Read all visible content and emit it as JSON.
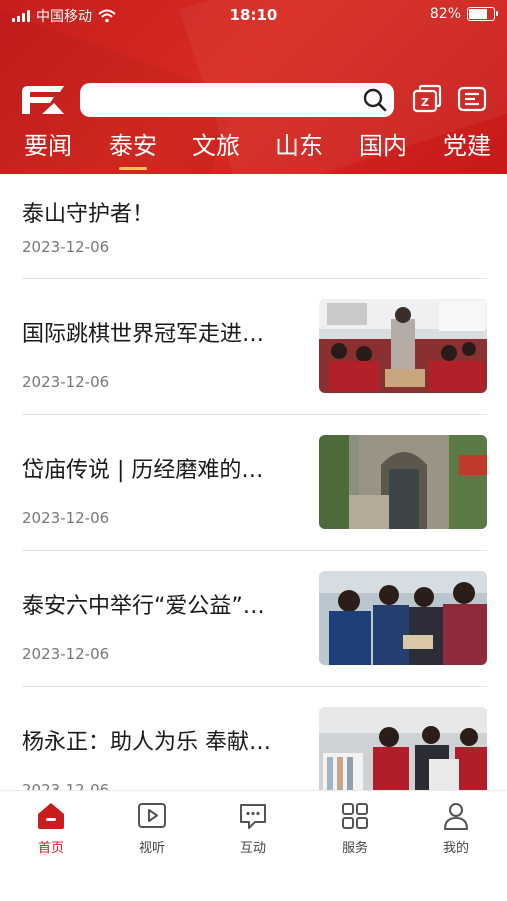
{
  "status_bar": {
    "carrier": "中国移动",
    "time": "18:10",
    "battery": "82%",
    "battery_level": 0.82
  },
  "search": {
    "placeholder": "",
    "value": ""
  },
  "tabs": [
    {
      "label": "要闻",
      "active": false
    },
    {
      "label": "泰安",
      "active": true
    },
    {
      "label": "文旅",
      "active": false
    },
    {
      "label": "山东",
      "active": false
    },
    {
      "label": "国内",
      "active": false
    },
    {
      "label": "党建",
      "active": false
    }
  ],
  "articles": [
    {
      "title": "泰山守护者！",
      "date": "2023-12-06",
      "has_image": false
    },
    {
      "title": "国际跳棋世界冠军走进…",
      "date": "2023-12-06",
      "has_image": true
    },
    {
      "title": "岱庙传说 | 历经磨难的…",
      "date": "2023-12-06",
      "has_image": true
    },
    {
      "title": "泰安六中举行“爱公益”…",
      "date": "2023-12-06",
      "has_image": true
    },
    {
      "title": "杨永正：助人为乐 奉献…",
      "date": "2023-12-06",
      "has_image": true
    }
  ],
  "bottom_nav": [
    {
      "label": "首页",
      "icon": "home-icon",
      "active": true
    },
    {
      "label": "视听",
      "icon": "play-icon",
      "active": false
    },
    {
      "label": "互动",
      "icon": "chat-icon",
      "active": false
    },
    {
      "label": "服务",
      "icon": "grid-icon",
      "active": false
    },
    {
      "label": "我的",
      "icon": "user-icon",
      "active": false
    }
  ],
  "colors": {
    "brand_red": "#c81d1d",
    "tab_underline": "#f0c35a"
  }
}
